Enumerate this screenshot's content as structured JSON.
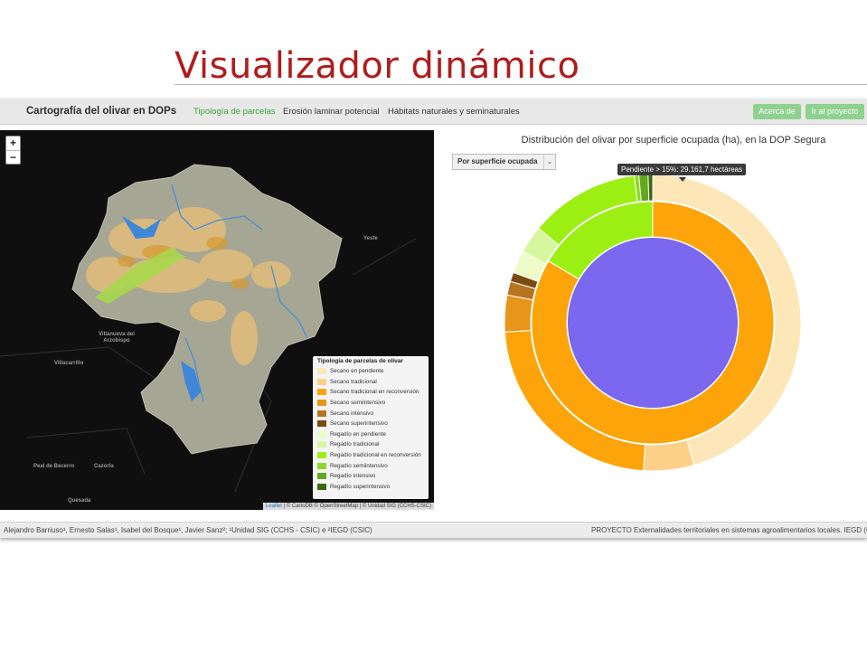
{
  "slide": {
    "title": "Visualizador dinámico"
  },
  "navbar": {
    "brand": "Cartografía del olivar en DOPs",
    "links": [
      "Tipología de parcelas",
      "Erosión laminar potencial",
      "Hábitats naturales y seminaturales"
    ],
    "buttons": [
      "Acerca de",
      "Ir al proyecto"
    ]
  },
  "map": {
    "zoom_in": "+",
    "zoom_out": "−",
    "places": [
      "Yeste",
      "Villanueva del Arzobispo",
      "Villacarrillo",
      "Peal de Becerro",
      "Cazorla",
      "Quesada"
    ],
    "legend": {
      "title": "Tipología de parcelas de olivar",
      "items": [
        {
          "label": "Secano en pendiente",
          "color": "#fde7b8"
        },
        {
          "label": "Secano tradicional",
          "color": "#fdd08a"
        },
        {
          "label": "Secano tradicional en reconversión",
          "color": "#fca40a"
        },
        {
          "label": "Secano semiintensivo",
          "color": "#e6961a"
        },
        {
          "label": "Secano intensivo",
          "color": "#b87420"
        },
        {
          "label": "Secano superintensivo",
          "color": "#7a4a10"
        },
        {
          "label": "Regadío en pendiente",
          "color": "#eefac8"
        },
        {
          "label": "Regadío tradicional",
          "color": "#d6f7a0"
        },
        {
          "label": "Regadío tradicional en reconversión",
          "color": "#9cef12"
        },
        {
          "label": "Regadío semiintensivo",
          "color": "#8ed82a"
        },
        {
          "label": "Regadío intensivo",
          "color": "#62a81c"
        },
        {
          "label": "Regadío superintensivo",
          "color": "#3a6a10"
        }
      ]
    },
    "attribution": {
      "leaflet": "Leaflet",
      "rest": " | © CartoDB © OpenStreetMap | © Unidad SIG (CCHS-CSIC)"
    }
  },
  "chart": {
    "title": "Distribución del olivar por superficie ocupada (ha), en la DOP Segura",
    "select_value": "Por superficie ocupada",
    "select_arrow": "⌄",
    "tooltip": "Pendiente > 15%: 29.161,7 hectáreas"
  },
  "chart_data": {
    "type": "pie",
    "title": "Distribución del olivar por superficie ocupada (ha), en la DOP Segura",
    "inner_ring": [
      {
        "name": "Secano",
        "share": 0.835,
        "color": "#fca40a"
      },
      {
        "name": "Regadío",
        "share": 0.165,
        "color": "#9cef12"
      }
    ],
    "outer_ring": [
      {
        "name": "Secano en pendiente",
        "share": 0.455,
        "color": "#fde7b8"
      },
      {
        "name": "Secano tradicional",
        "share": 0.055,
        "color": "#fdd08a"
      },
      {
        "name": "Secano tradicional en reconversión",
        "share": 0.23,
        "color": "#fca40a"
      },
      {
        "name": "Secano semiintensivo",
        "share": 0.04,
        "color": "#e6961a"
      },
      {
        "name": "Secano intensivo",
        "share": 0.015,
        "color": "#b87420"
      },
      {
        "name": "Secano superintensivo",
        "share": 0.01,
        "color": "#7a4a10"
      },
      {
        "name": "Regadío en pendiente",
        "share": 0.025,
        "color": "#eefac8"
      },
      {
        "name": "Regadío tradicional",
        "share": 0.03,
        "color": "#d6f7a0"
      },
      {
        "name": "Regadío tradicional en reconversión",
        "share": 0.12,
        "color": "#9cef12"
      },
      {
        "name": "Regadío semiintensivo",
        "share": 0.005,
        "color": "#8ed82a"
      },
      {
        "name": "Regadío intensivo",
        "share": 0.01,
        "color": "#62a81c"
      },
      {
        "name": "Regadío superintensivo",
        "share": 0.005,
        "color": "#3a6a10"
      }
    ],
    "center_color": "#7b68ee"
  },
  "footer": {
    "left": "Alejandro Barriuso¹, Ernesto Salas¹, Isabel del Bosque¹, Javier Sanz²; ¹Unidad SIG (CCHS - CSIC) e ²IEGD (CSIC)",
    "right": "PROYECTO Externalidades territoriales en sistemas agroalimentarios locales. IEGD (C"
  }
}
